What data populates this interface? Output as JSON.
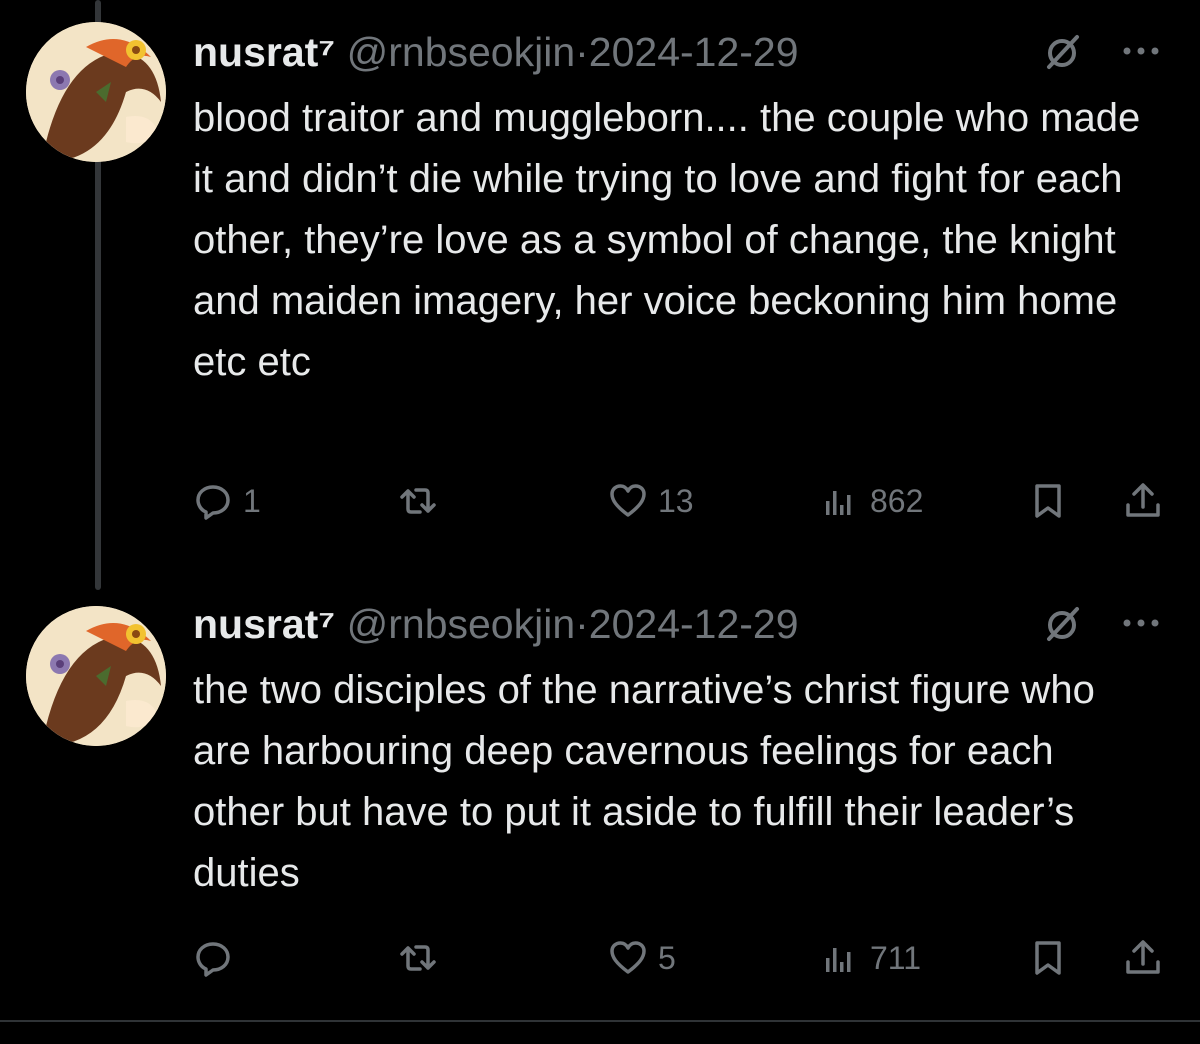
{
  "tweets": [
    {
      "name": "nusrat⁷",
      "handle": "@rnbseokjin",
      "separator": "·",
      "date": "2024-12-29",
      "text": "blood traitor and muggleborn.... the couple who made it and didn’t die while trying to love and fight for each other, they’re love as a symbol of change, the knight and maiden imagery, her voice beckoning him home etc etc",
      "replies": "1",
      "retweets": "",
      "likes": "13",
      "views": "862"
    },
    {
      "name": "nusrat⁷",
      "handle": "@rnbseokjin",
      "separator": "·",
      "date": "2024-12-29",
      "text": "the two disciples of the narrative’s christ figure who are harbouring deep cavernous feelings for each other but have to put it aside to fulfill their leader’s duties",
      "replies": "",
      "retweets": "",
      "likes": "5",
      "views": "711"
    }
  ],
  "colors": {
    "background": "#000000",
    "text_primary": "#e7e9ea",
    "text_secondary": "#71767b",
    "thread_line": "#333639"
  },
  "icons": [
    "reply-icon",
    "retweet-icon",
    "like-icon",
    "views-icon",
    "bookmark-icon",
    "share-icon",
    "mute-icon",
    "more-icon"
  ]
}
